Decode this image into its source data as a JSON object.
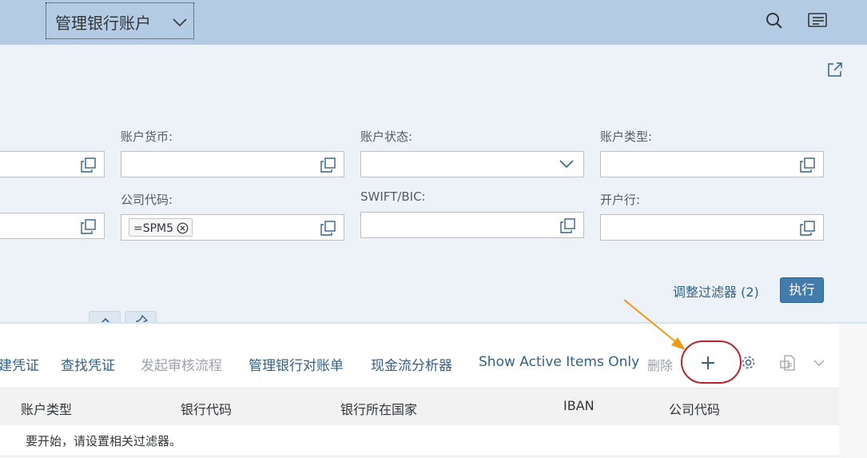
{
  "app": {
    "title": "管理银行账户"
  },
  "filters": {
    "account_currency_label": "账户货币:",
    "account_status_label": "账户状态:",
    "account_type_label": "账户类型:",
    "company_code_label": "公司代码:",
    "company_code_token": "=SPM5",
    "swift_label": "SWIFT/BIC:",
    "bank_branch_label": "开户行:",
    "adapt_filters_label": "调整过滤器 (2)",
    "go_label": "执行"
  },
  "toolbar": {
    "create_doc_label": "建凭证",
    "find_doc_label": "查找凭证",
    "start_review_label": "发起审核流程",
    "manage_statements_label": "管理银行对账单",
    "cash_flow_label": "现金流分析器",
    "show_active_label": "Show Active Items Only",
    "delete_label": "删除"
  },
  "table": {
    "columns": [
      "账户类型",
      "银行代码",
      "银行所在国家",
      "IBAN",
      "公司代码"
    ],
    "empty_text": "要开始，请设置相关过滤器。"
  },
  "icons": {
    "search": "search-icon",
    "menu": "menu-icon",
    "share": "share-icon",
    "value_help": "value-help-icon",
    "add": "add-icon",
    "settings": "gear-icon",
    "export": "export-icon"
  },
  "colors": {
    "shell": "#b3cbe3",
    "filterbar": "#edf2f8",
    "link": "#346187",
    "primary_button": "#427cac",
    "annotation_ring": "#b5262c",
    "annotation_arrow": "#f29b12"
  }
}
